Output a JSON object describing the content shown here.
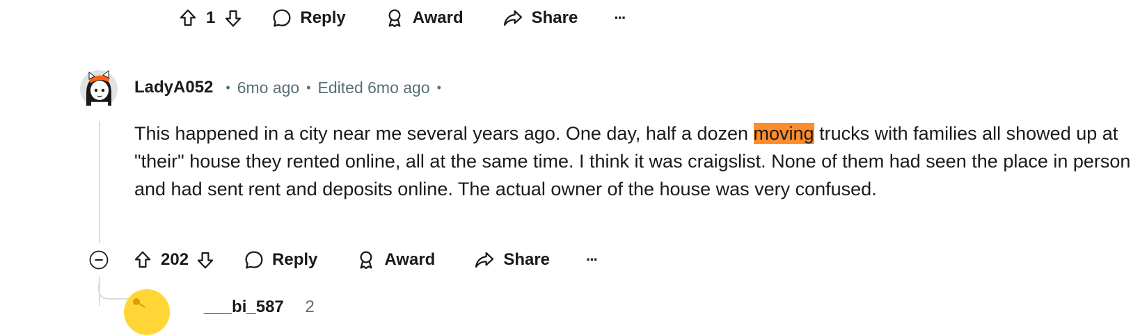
{
  "top_actions": {
    "vote_count": "1",
    "reply_label": "Reply",
    "award_label": "Award",
    "share_label": "Share",
    "more_label": "···"
  },
  "comment": {
    "username": "LadyA052",
    "sep1": "•",
    "time": "6mo ago",
    "sep2": "•",
    "edited": "Edited 6mo ago",
    "sep3": "•",
    "body_before": "This happened in a city near me several years ago. One day, half a dozen ",
    "body_highlight": "moving",
    "body_after": " trucks with families all showed up at \"their\" house they rented online, all at the same time. I think it was craigslist. None of them had seen the place in person and had sent rent and deposits online. The actual owner of the house was very confused.",
    "highlight_color": "#ff8c2b"
  },
  "comment_actions": {
    "collapse_label": "−",
    "vote_count": "202",
    "reply_label": "Reply",
    "award_label": "Award",
    "share_label": "Share",
    "more_label": "···"
  },
  "reply_preview": {
    "username_partial": "___bi_587",
    "time_partial": "2"
  }
}
